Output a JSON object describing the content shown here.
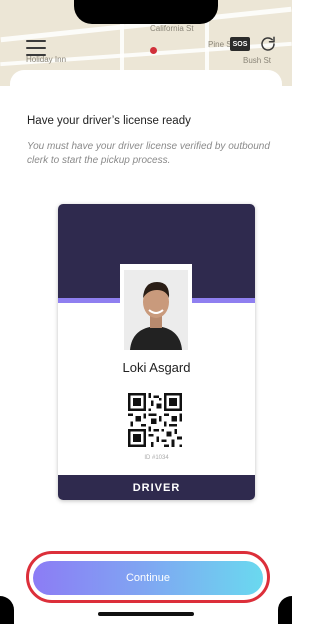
{
  "map": {
    "labels": [
      "Holiday Inn",
      "Pine St",
      "Bush St",
      "California St"
    ]
  },
  "header": {
    "menu_icon": "hamburger-menu-icon",
    "sos_label": "SOS",
    "refresh_icon": "refresh-icon"
  },
  "content": {
    "title": "Have your driver’s license ready",
    "subtitle": "You must have your driver license verified by outbound clerk to start the pickup process."
  },
  "card": {
    "name": "Loki Asgard",
    "id_text": "ID #1034",
    "role": "DRIVER",
    "colors": {
      "header": "#2f2a4e",
      "stripe": "#8f7ff0"
    }
  },
  "action": {
    "continue_label": "Continue",
    "highlight_color": "#dc2f3a",
    "gradient": [
      "#8c7cf5",
      "#6ad9ef"
    ]
  }
}
